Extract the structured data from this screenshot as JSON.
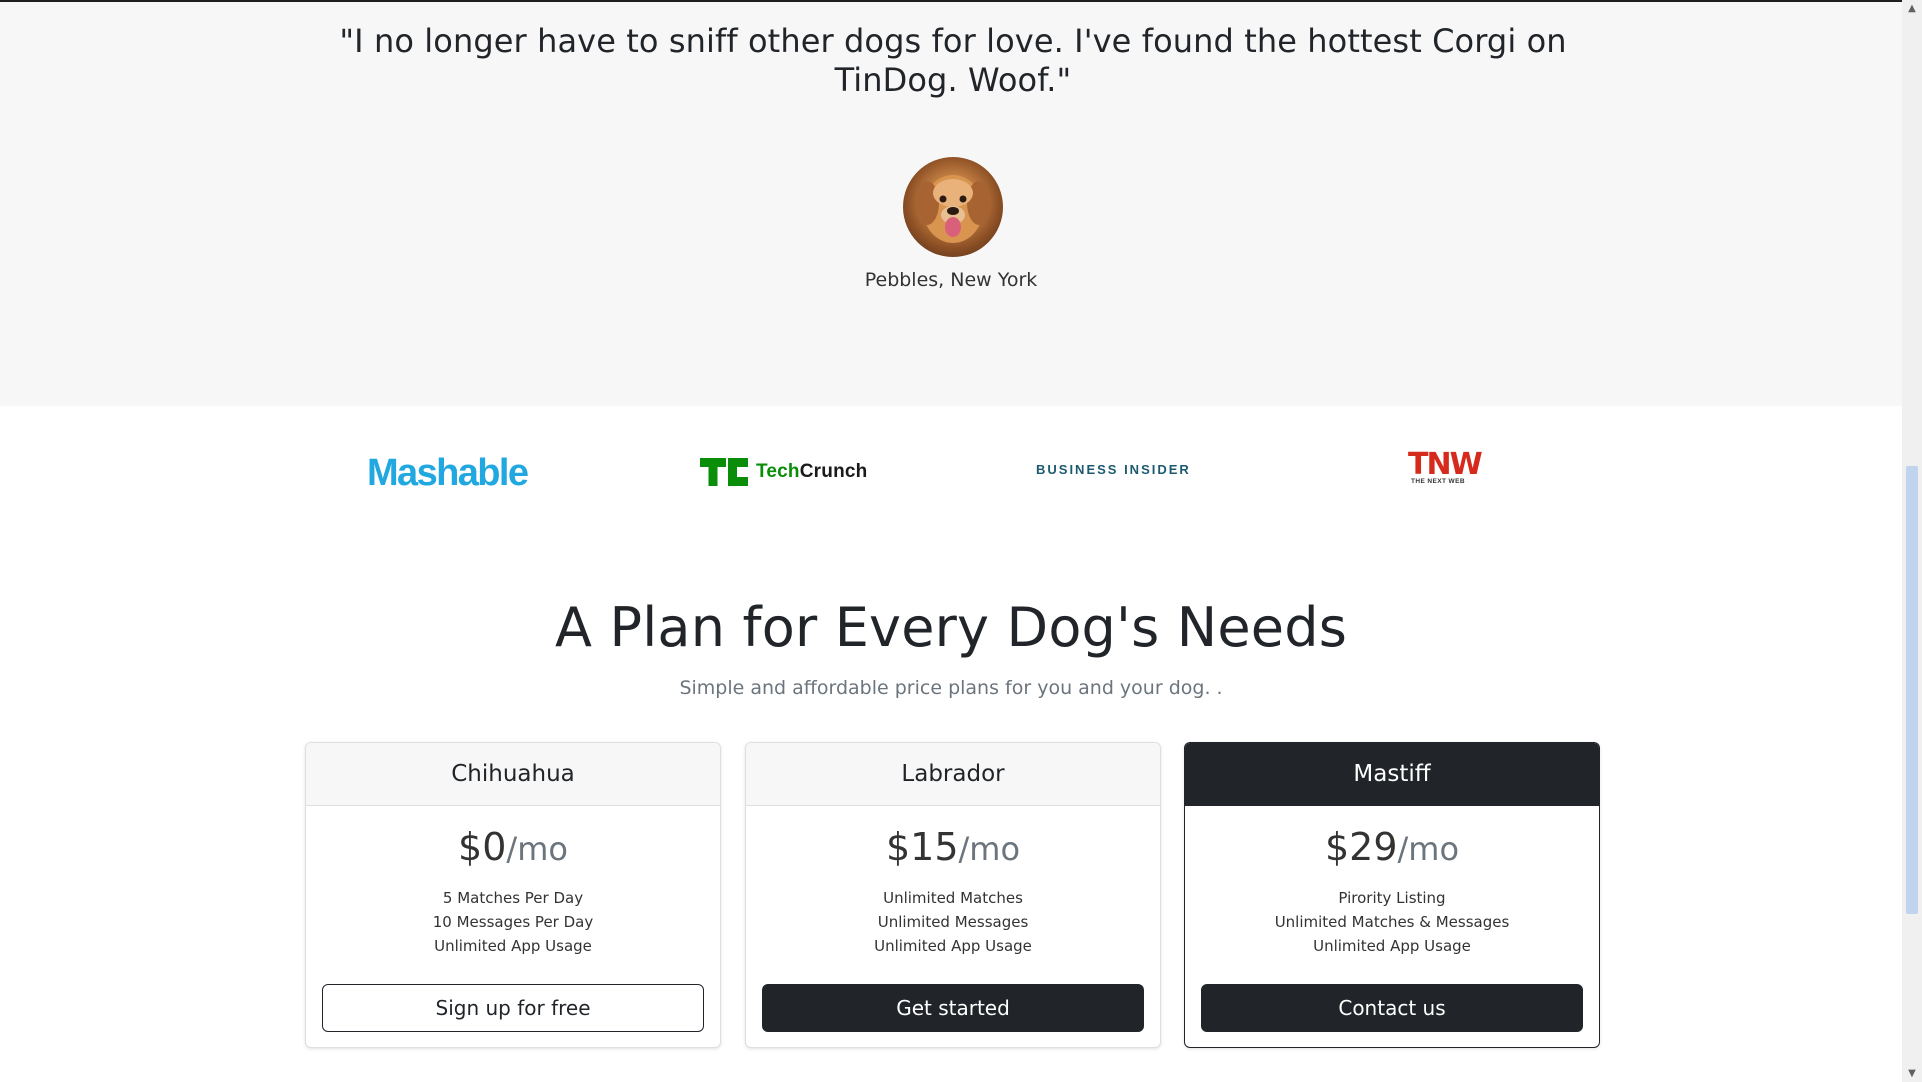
{
  "testimonial": {
    "quote": "\"I no longer have to sniff other dogs for love. I've found the hottest Corgi on TinDog. Woof.\"",
    "author": "Pebbles, New York"
  },
  "press": {
    "mashable": "Mashable",
    "techcrunch": {
      "mark": "TC",
      "word_prefix": "Tech",
      "word_suffix": "Crunch"
    },
    "business_insider": "BUSINESS INSIDER",
    "tnw": {
      "mark": "TNW",
      "tagline": "THE NEXT WEB"
    }
  },
  "pricing": {
    "title": "A Plan for Every Dog's Needs",
    "subtitle": "Simple and affordable price plans for you and your dog. .",
    "plans": [
      {
        "name": "Chihuahua",
        "price": "$0",
        "unit": "/mo",
        "features": [
          "5 Matches Per Day",
          "10 Messages Per Day",
          "Unlimited App Usage"
        ],
        "cta": "Sign up for free"
      },
      {
        "name": "Labrador",
        "price": "$15",
        "unit": "/mo",
        "features": [
          "Unlimited Matches",
          "Unlimited Messages",
          "Unlimited App Usage"
        ],
        "cta": "Get started"
      },
      {
        "name": "Mastiff",
        "price": "$29",
        "unit": "/mo",
        "features": [
          "Pirority Listing",
          "Unlimited Matches & Messages",
          "Unlimited App Usage"
        ],
        "cta": "Contact us"
      }
    ]
  },
  "colors": {
    "dark": "#212529",
    "testimonial_bg": "#f7f7f8",
    "mashable_blue": "#21a8e0",
    "techcrunch_green": "#0a8e0a",
    "business_insider_teal": "#1d5a70",
    "tnw_red": "#d62b1c"
  },
  "scrollbar": {
    "up_icon": "chevron-up-icon",
    "down_icon": "chevron-down-icon"
  }
}
